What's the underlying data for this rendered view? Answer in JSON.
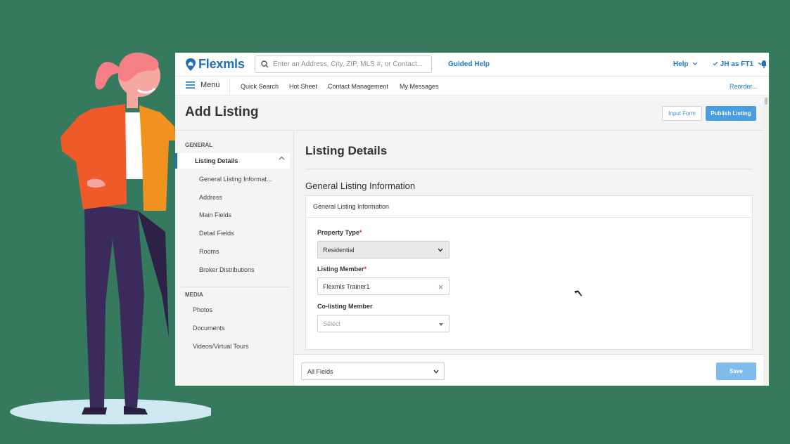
{
  "app": {
    "logo": "Flexmls",
    "search_placeholder": "Enter an Address, City, ZIP, MLS #, or Contact...",
    "guided_help": "Guided Help",
    "help": "Help",
    "user": "JH as FT1"
  },
  "nav": {
    "menu": "Menu",
    "items": [
      "Quick Search",
      "Hot Sheet",
      "Contact Management",
      "My Messages"
    ],
    "reorder": "Reorder..."
  },
  "page": {
    "title": "Add Listing",
    "input_form": "Input Form",
    "publish": "Publish Listing"
  },
  "sidebar": {
    "general_label": "GENERAL",
    "active_item": "Listing Details",
    "general_items": [
      "General Listing Informat...",
      "Address",
      "Main Fields",
      "Detail Fields",
      "Rooms",
      "Broker Distributions"
    ],
    "media_label": "MEDIA",
    "media_items": [
      "Photos",
      "Documents",
      "Videos/Virtual Tours"
    ]
  },
  "main": {
    "title": "Listing Details",
    "section": "General Listing Information",
    "card_title": "General Listing Information",
    "property_type_label": "Property Type",
    "property_type_value": "Residential",
    "listing_member_label": "Listing Member",
    "listing_member_value": "Flexmls Trainer1",
    "colisting_label": "Co-listing Member",
    "colisting_placeholder": "Select",
    "required_mark": "*"
  },
  "footer": {
    "fields_select": "All Fields",
    "save": "Save"
  },
  "colors": {
    "background": "#357a5f",
    "brand_blue": "#1f6fb5",
    "publish_blue": "#4a9ee0",
    "save_blue": "#7fbcec"
  }
}
